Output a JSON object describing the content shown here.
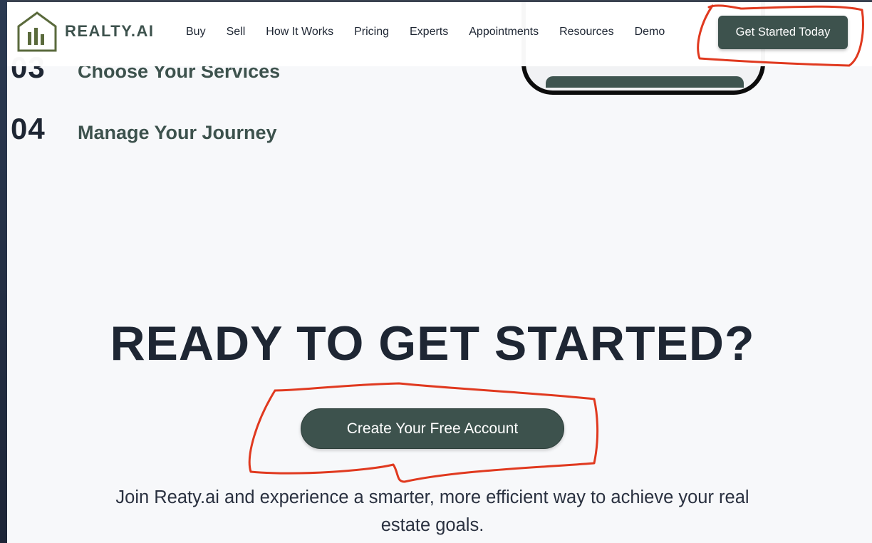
{
  "brand": {
    "name": "REALTY.AI",
    "logo_icon": "house-bar-chart-icon",
    "accent_color": "#3d524d",
    "logo_color": "#5a6a3c"
  },
  "nav": {
    "items": [
      {
        "label": "Buy"
      },
      {
        "label": "Sell"
      },
      {
        "label": "How It Works"
      },
      {
        "label": "Pricing"
      },
      {
        "label": "Experts"
      },
      {
        "label": "Appointments"
      },
      {
        "label": "Resources"
      },
      {
        "label": "Demo"
      }
    ],
    "cta_label": "Get Started Today"
  },
  "steps": [
    {
      "number": "03",
      "title": "Choose Your Services"
    },
    {
      "number": "04",
      "title": "Manage Your Journey"
    }
  ],
  "cta_section": {
    "heading": "READY TO GET STARTED?",
    "button_label": "Create Your Free Account",
    "subtext": "Join Reaty.ai and experience a smarter, more efficient way to achieve your real estate goals."
  },
  "annotations": {
    "color": "#e0391f"
  }
}
